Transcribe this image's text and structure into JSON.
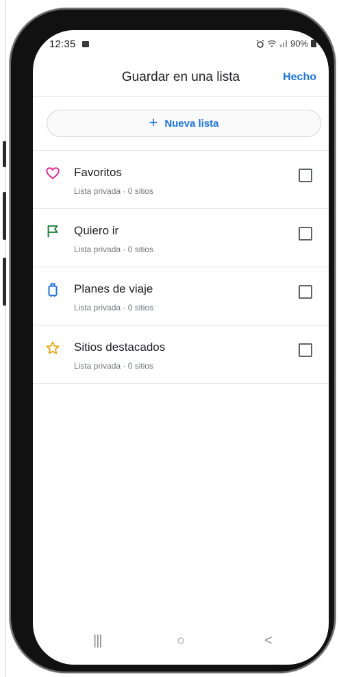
{
  "status_bar": {
    "time": "12:35",
    "battery": "90%"
  },
  "header": {
    "title": "Guardar en una lista",
    "done_label": "Hecho"
  },
  "new_list": {
    "plus": "+",
    "label": "Nueva lista"
  },
  "lists": [
    {
      "name": "Favoritos",
      "meta": "Lista privada · 0 sitios",
      "icon": "heart-icon",
      "color": "#e52592",
      "checked": false
    },
    {
      "name": "Quiero ir",
      "meta": "Lista privada · 0 sitios",
      "icon": "flag-icon",
      "color": "#188038",
      "checked": false
    },
    {
      "name": "Planes de viaje",
      "meta": "Lista privada · 0 sitios",
      "icon": "suitcase-icon",
      "color": "#1a73e8",
      "checked": false
    },
    {
      "name": "Sitios destacados",
      "meta": "Lista privada · 0 sitios",
      "icon": "star-icon",
      "color": "#e8a600",
      "checked": false
    }
  ],
  "nav_bar": {
    "recents": "|||",
    "home": "○",
    "back": "<"
  }
}
